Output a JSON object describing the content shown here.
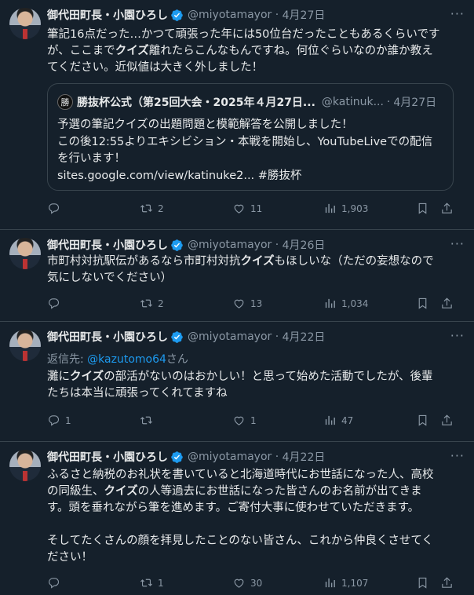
{
  "author": {
    "name": "御代田町長・小園ひろし",
    "handle": "@miyotamayor"
  },
  "tweets": [
    {
      "date": "4月27日",
      "text_lines": [
        [
          {
            "t": "筆記16点だった…かつて頑張った年には50位台だったこともあるくらいです"
          }
        ],
        [
          {
            "t": "が、ここまで"
          },
          {
            "t": "クイズ",
            "b": true
          },
          {
            "t": "離れたらこんなもんですね。何位ぐらいなのか誰か教え"
          }
        ],
        [
          {
            "t": "てください。近似値は大きく外しました！"
          }
        ]
      ],
      "quote": {
        "avatar_glyph": "勝",
        "name": "勝抜杯公式（第25回大会・2025年４月27日...",
        "handle": "@katinuk...",
        "date": "4月27日",
        "lines": [
          "予選の筆記クイズの出題問題と模範解答を公開しました！",
          "この後12:55よりエキシビション・本戦を開始し、YouTubeLiveでの配信",
          "を行います！",
          "sites.google.com/view/katinuke2... #勝抜杯"
        ]
      },
      "replies": "",
      "retweets": "2",
      "likes": "11",
      "views": "1,903"
    },
    {
      "date": "4月26日",
      "text_lines": [
        [
          {
            "t": "市町村対抗駅伝があるなら市町村対抗"
          },
          {
            "t": "クイズ",
            "b": true
          },
          {
            "t": "もほしいな（ただの妄想なので"
          }
        ],
        [
          {
            "t": "気にしないでください）"
          }
        ]
      ],
      "replies": "",
      "retweets": "2",
      "likes": "13",
      "views": "1,034"
    },
    {
      "date": "4月22日",
      "reply_to": {
        "prefix": "返信先: ",
        "user": "@kazutomo64",
        "suffix": "さん"
      },
      "text_lines": [
        [
          {
            "t": "灘に"
          },
          {
            "t": "クイズ",
            "b": true
          },
          {
            "t": "の部活がないのはおかしい！と思って始めた活動でしたが、後輩"
          }
        ],
        [
          {
            "t": "たちは本当に頑張ってくれてますね"
          }
        ]
      ],
      "replies": "1",
      "retweets": "",
      "likes": "1",
      "views": "47"
    },
    {
      "date": "4月22日",
      "text_lines": [
        [
          {
            "t": "ふるさと納税のお礼状を書いていると北海道時代にお世話になった人、高校"
          }
        ],
        [
          {
            "t": "の同級生、"
          },
          {
            "t": "クイズ",
            "b": true
          },
          {
            "t": "の人等過去にお世話になった皆さんのお名前が出てきま"
          }
        ],
        [
          {
            "t": "す。頭を垂れながら筆を進めます。ご寄付大事に使わせていただきます。"
          }
        ],
        [
          {
            "t": ""
          }
        ],
        [
          {
            "t": "そしてたくさんの顔を拝見したことのない皆さん、これから仲良くさせてく"
          }
        ],
        [
          {
            "t": "ださい！"
          }
        ]
      ],
      "replies": "",
      "retweets": "1",
      "likes": "30",
      "views": "1,107"
    }
  ],
  "colors": {
    "background": "#15202b",
    "text": "#e7e9ea",
    "secondary": "#8b98a5",
    "link": "#1d9bf0",
    "verified": "#1d9bf0",
    "divider": "#38444d"
  },
  "icons": [
    "verified-badge-icon",
    "more-icon",
    "reply-icon",
    "retweet-icon",
    "like-icon",
    "views-icon",
    "bookmark-icon",
    "share-icon"
  ]
}
